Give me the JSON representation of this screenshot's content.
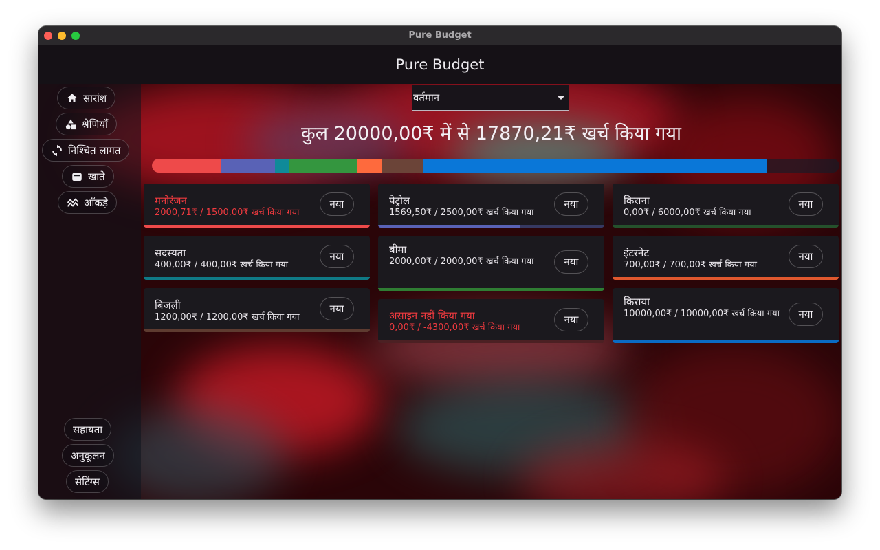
{
  "window": {
    "title": "Pure Budget"
  },
  "appbar": {
    "title": "Pure Budget"
  },
  "sidebar": {
    "top_items": [
      {
        "label": "सारांश",
        "icon": "home-icon"
      },
      {
        "label": "श्रेणियाँ",
        "icon": "categories-icon"
      },
      {
        "label": "निश्चित लागत",
        "icon": "recurring-icon"
      },
      {
        "label": "खाते",
        "icon": "wallet-icon"
      },
      {
        "label": "आँकड़े",
        "icon": "stats-icon"
      }
    ],
    "bottom_items": [
      {
        "label": "सहायता"
      },
      {
        "label": "अनुकूलन"
      },
      {
        "label": "सेटिंग्स"
      }
    ]
  },
  "period_select": {
    "value": "वर्तमान"
  },
  "summary": {
    "headline": "कुल 20000,00₹ में से 17870,21₹ खर्च किया गया"
  },
  "budget_bar": {
    "segments": [
      {
        "name": "मनोरंजन",
        "amount": 2000.71,
        "color": "#ee4a4a"
      },
      {
        "name": "पेट्रोल",
        "amount": 1569.5,
        "color": "#5962b6"
      },
      {
        "name": "सदस्यता",
        "amount": 400.0,
        "color": "#0f8a99"
      },
      {
        "name": "बीमा",
        "amount": 2000.0,
        "color": "#34963f"
      },
      {
        "name": "इंटरनेट",
        "amount": 700.0,
        "color": "#fe6a3d"
      },
      {
        "name": "बिजली",
        "amount": 1200.0,
        "color": "#6b4438"
      },
      {
        "name": "किराया",
        "amount": 10000.0,
        "color": "#0a77d8"
      }
    ],
    "total": 20000.0
  },
  "new_button_label": "नया",
  "cards": [
    {
      "title": "मनोरंजन",
      "subtitle": "2000,71₹ / 1500,00₹ खर्च किया गया",
      "progress": 1.0,
      "color": "#ee4a4a",
      "over": true
    },
    {
      "title": "पेट्रोल",
      "subtitle": "1569,50₹ / 2500,00₹ खर्च किया गया",
      "progress": 0.628,
      "color": "#5962b6",
      "over": false
    },
    {
      "title": "किराना",
      "subtitle": "0,00₹ / 6000,00₹ खर्च किया गया",
      "progress": 0.0,
      "color": "#34963f",
      "over": false
    },
    {
      "title": "सदस्यता",
      "subtitle": "400,00₹ / 400,00₹ खर्च किया गया",
      "progress": 1.0,
      "color": "#0f7a86",
      "over": false
    },
    {
      "title": "बीमा",
      "subtitle": "2000,00₹ / 2000,00₹ खर्च किया गया",
      "progress": 1.0,
      "color": "#2f7d33",
      "over": false
    },
    {
      "title": "इंटरनेट",
      "subtitle": "700,00₹ / 700,00₹ खर्च किया गया",
      "progress": 1.0,
      "color": "#e0582e",
      "over": false
    },
    {
      "title": "बिजली",
      "subtitle": "1200,00₹ / 1200,00₹ खर्च किया गया",
      "progress": 1.0,
      "color": "#5e3b30",
      "over": false
    },
    {
      "title": "असाइन नहीं किया गया",
      "subtitle": "0,00₹ / -4300,00₹ खर्च किया गया",
      "progress": 0.0,
      "color": "#8a2a2a",
      "over": true
    },
    {
      "title": "किराया",
      "subtitle": "10000,00₹ / 10000,00₹ खर्च किया गया",
      "progress": 1.0,
      "color": "#0a6bc4",
      "over": false
    }
  ]
}
